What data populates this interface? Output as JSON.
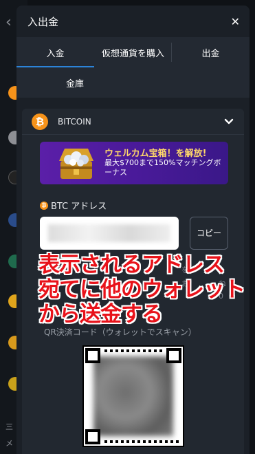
{
  "modal": {
    "title": "入出金",
    "close_icon": "close-icon"
  },
  "tabs": [
    {
      "label": "入金",
      "active": true
    },
    {
      "label": "仮想通貨を購入",
      "active": false
    },
    {
      "label": "出金",
      "active": false
    },
    {
      "label": "金庫",
      "active": false
    }
  ],
  "coin": {
    "symbol": "₿",
    "name": "BITCOIN",
    "icon": "bitcoin-icon",
    "chevron_icon": "chevron-down-icon"
  },
  "banner": {
    "title": "ウェルカム宝箱！を解放!",
    "subtitle": "最大$700まで150%マッチングボーナス"
  },
  "address": {
    "label": "BTC アドレス",
    "copy_label": "コピー"
  },
  "qr": {
    "caption": "QR決済コード（ウォレットでスキャン）"
  },
  "annotation": {
    "line1": "表示されるアドレス",
    "line2": "宛てに他のウォレット",
    "line3": "から送金する"
  },
  "background": {
    "footer_text_1": "三",
    "footer_text_2": "メ"
  },
  "colors": {
    "accent": "#2c83d8",
    "bitcoin": "#f7931a",
    "annotation": "#e8121a"
  }
}
